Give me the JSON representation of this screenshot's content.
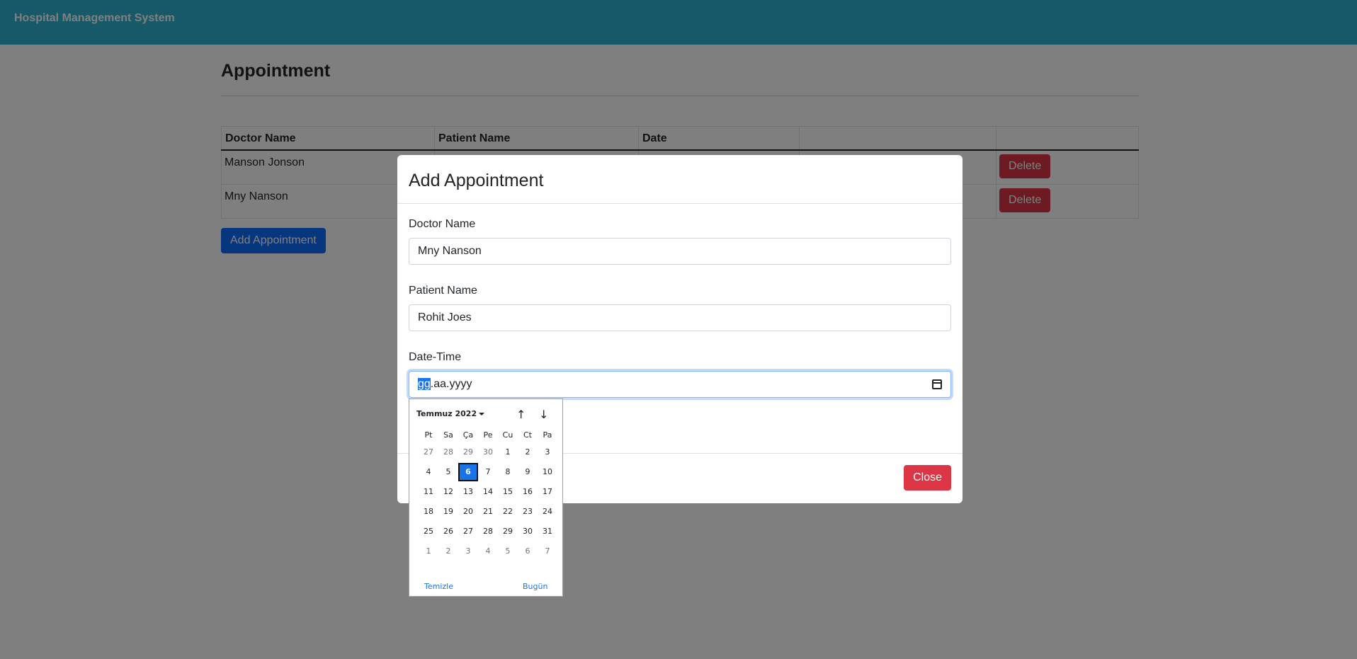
{
  "navbar": {
    "brand": "Hospital Management System"
  },
  "page": {
    "title": "Appointment"
  },
  "table": {
    "headers": [
      "Doctor Name",
      "Patient Name",
      "Date",
      "",
      ""
    ],
    "rows": [
      {
        "doctor": "Manson Jonson",
        "delete_label": "Delete"
      },
      {
        "doctor": "Mny Nanson",
        "delete_label": "Delete"
      }
    ]
  },
  "add_button": "Add Appointment",
  "modal": {
    "title": "Add Appointment",
    "doctor_label": "Doctor Name",
    "doctor_value": "Mny Nanson",
    "patient_label": "Patient Name",
    "patient_value": "Rohit Joes",
    "datetime_label": "Date-Time",
    "datetime_selected": "gg",
    "datetime_rest": ".aa.yyyy",
    "close_label": "Close"
  },
  "picker": {
    "month_label": "Temmuz 2022",
    "weekdays": [
      "Pt",
      "Sa",
      "Ça",
      "Pe",
      "Cu",
      "Ct",
      "Pa"
    ],
    "weeks": [
      [
        "27",
        "28",
        "29",
        "30",
        "1",
        "2",
        "3"
      ],
      [
        "4",
        "5",
        "6",
        "7",
        "8",
        "9",
        "10"
      ],
      [
        "11",
        "12",
        "13",
        "14",
        "15",
        "16",
        "17"
      ],
      [
        "18",
        "19",
        "20",
        "21",
        "22",
        "23",
        "24"
      ],
      [
        "25",
        "26",
        "27",
        "28",
        "29",
        "30",
        "31"
      ],
      [
        "1",
        "2",
        "3",
        "4",
        "5",
        "6",
        "7"
      ]
    ],
    "today": "6",
    "clear_label": "Temizle",
    "today_label": "Bugün"
  }
}
